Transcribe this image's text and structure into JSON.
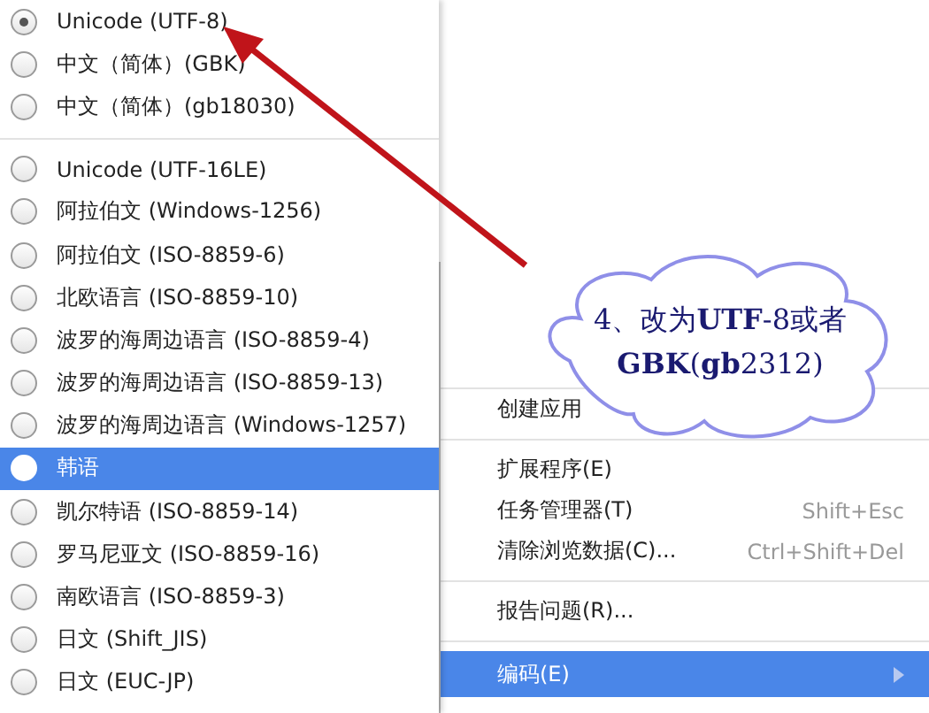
{
  "encoding_menu": {
    "groups": [
      [
        {
          "label": "Unicode (UTF-8)",
          "selected": true,
          "highlighted": false
        },
        {
          "label": "中文（简体）(GBK)",
          "selected": false,
          "highlighted": false
        },
        {
          "label": "中文（简体）(gb18030)",
          "selected": false,
          "highlighted": false
        }
      ],
      [
        {
          "label": "Unicode (UTF-16LE)",
          "selected": false,
          "highlighted": false
        },
        {
          "label": "阿拉伯文 (Windows-1256)",
          "selected": false,
          "highlighted": false
        },
        {
          "label": "阿拉伯文 (ISO-8859-6)",
          "selected": false,
          "highlighted": false
        },
        {
          "label": "北欧语言 (ISO-8859-10)",
          "selected": false,
          "highlighted": false
        },
        {
          "label": "波罗的海周边语言 (ISO-8859-4)",
          "selected": false,
          "highlighted": false
        },
        {
          "label": "波罗的海周边语言 (ISO-8859-13)",
          "selected": false,
          "highlighted": false
        },
        {
          "label": "波罗的海周边语言 (Windows-1257)",
          "selected": false,
          "highlighted": false
        },
        {
          "label": "韩语",
          "selected": false,
          "highlighted": true
        },
        {
          "label": "凯尔特语 (ISO-8859-14)",
          "selected": false,
          "highlighted": false
        },
        {
          "label": "罗马尼亚文 (ISO-8859-16)",
          "selected": false,
          "highlighted": false
        },
        {
          "label": "南欧语言 (ISO-8859-3)",
          "selected": false,
          "highlighted": false
        },
        {
          "label": "日文 (Shift_JIS)",
          "selected": false,
          "highlighted": false
        },
        {
          "label": "日文 (EUC-JP)",
          "selected": false,
          "highlighted": false
        }
      ]
    ]
  },
  "tools_menu": {
    "groups": [
      [
        {
          "label": "创建应用",
          "highlighted": false
        }
      ],
      [
        {
          "label": "扩展程序(E)",
          "highlighted": false
        },
        {
          "label": "任务管理器(T)",
          "shortcut": "Shift+Esc",
          "highlighted": false
        },
        {
          "label": "清除浏览数据(C)...",
          "shortcut": "Ctrl+Shift+Del",
          "highlighted": false
        }
      ],
      [
        {
          "label": "报告问题(R)...",
          "highlighted": false
        }
      ],
      [
        {
          "label": "编码(E)",
          "highlighted": true,
          "submenu": true
        }
      ]
    ]
  },
  "callout": {
    "lines": [
      "4、改为**UTF**-8或者",
      "**GBK**(**gb**2312)"
    ]
  }
}
